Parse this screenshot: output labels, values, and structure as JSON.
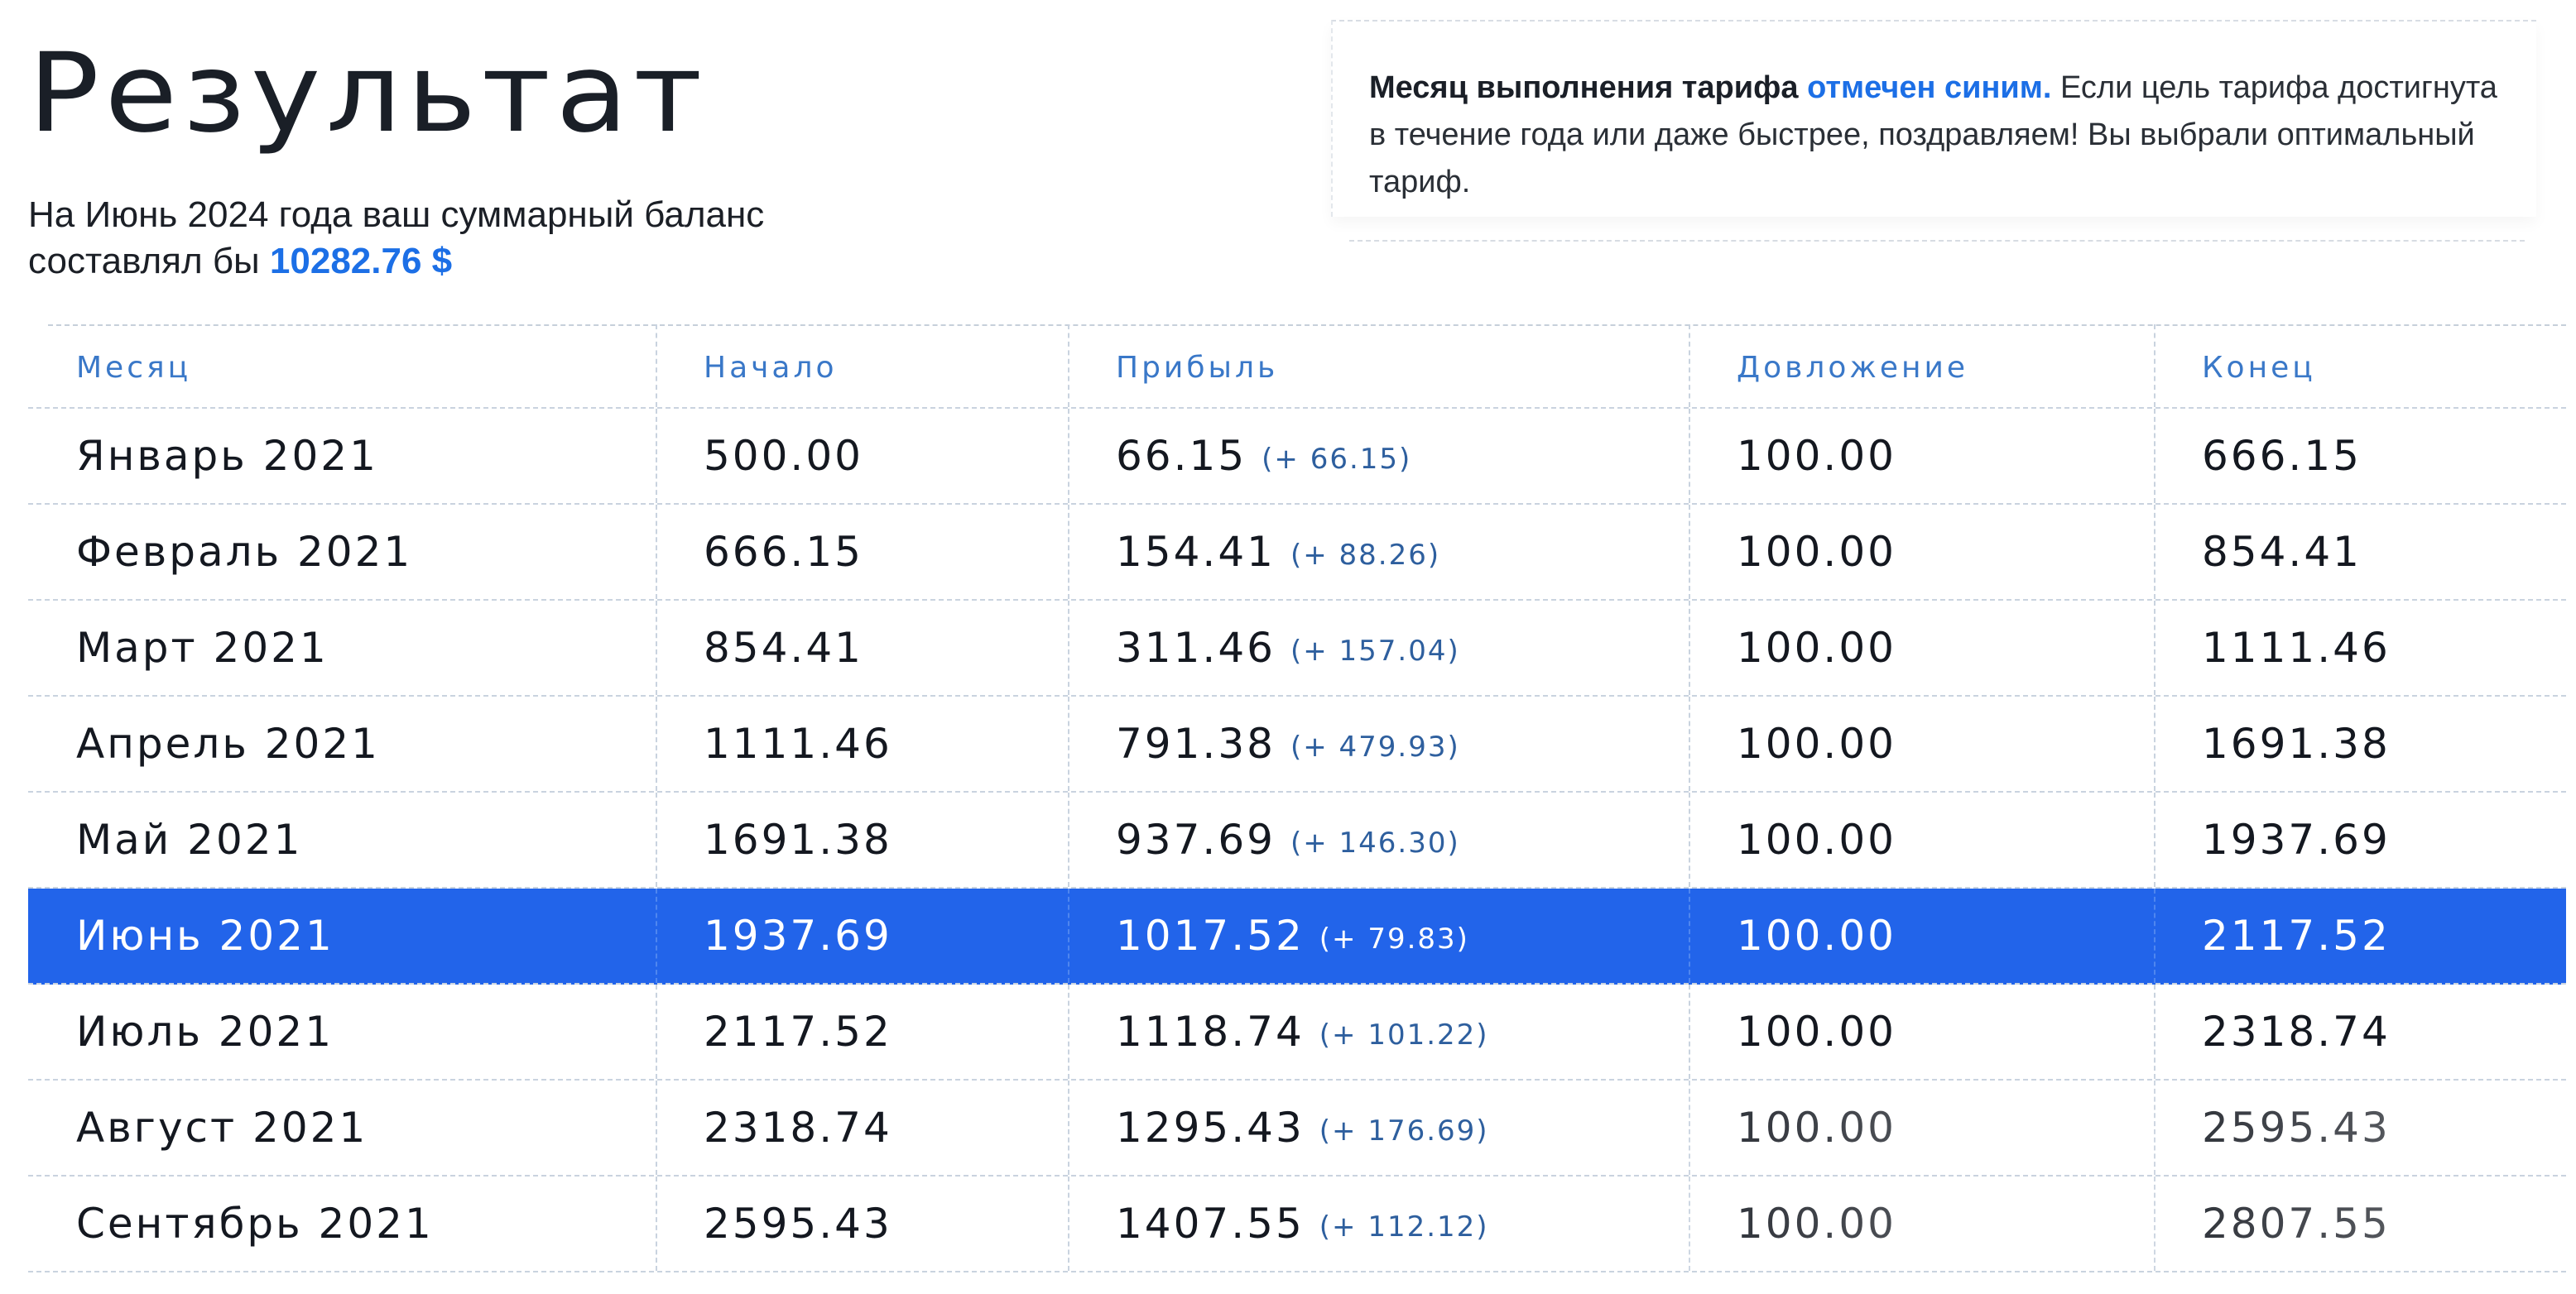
{
  "page": {
    "title": "Результат",
    "summary_text": "На Июнь 2024 года ваш суммарный баланс составлял бы",
    "summary_amount": "10282.76 $"
  },
  "note": {
    "lead_bold": "Месяц выполнения тарифа",
    "lead_blue": "отмечен синим.",
    "text": "Если цель тарифа достигнута в течение года или даже быстрее, поздравляем! Вы выбрали оптимальный тариф."
  },
  "colors": {
    "accent": "#1c6fe6",
    "highlight_row": "#2264ea",
    "header_text": "#3a78c8"
  },
  "table": {
    "columns": [
      "Месяц",
      "Начало",
      "Прибыль",
      "Довложение",
      "Конец"
    ],
    "highlighted_row_index": 5,
    "rows": [
      {
        "month": "Январь 2021",
        "start": "500.00",
        "profit": "66.15",
        "delta": "(+ 66.15)",
        "deposit": "100.00",
        "end": "666.15"
      },
      {
        "month": "Февраль 2021",
        "start": "666.15",
        "profit": "154.41",
        "delta": "(+ 88.26)",
        "deposit": "100.00",
        "end": "854.41"
      },
      {
        "month": "Март 2021",
        "start": "854.41",
        "profit": "311.46",
        "delta": "(+ 157.04)",
        "deposit": "100.00",
        "end": "1111.46"
      },
      {
        "month": "Апрель 2021",
        "start": "1111.46",
        "profit": "791.38",
        "delta": "(+ 479.93)",
        "deposit": "100.00",
        "end": "1691.38"
      },
      {
        "month": "Май 2021",
        "start": "1691.38",
        "profit": "937.69",
        "delta": "(+ 146.30)",
        "deposit": "100.00",
        "end": "1937.69"
      },
      {
        "month": "Июнь 2021",
        "start": "1937.69",
        "profit": "1017.52",
        "delta": "(+ 79.83)",
        "deposit": "100.00",
        "end": "2117.52"
      },
      {
        "month": "Июль 2021",
        "start": "2117.52",
        "profit": "1118.74",
        "delta": "(+ 101.22)",
        "deposit": "100.00",
        "end": "2318.74"
      },
      {
        "month": "Август 2021",
        "start": "2318.74",
        "profit": "1295.43",
        "delta": "(+ 176.69)",
        "deposit": "100.00",
        "end": "2595.43"
      },
      {
        "month": "Сентябрь 2021",
        "start": "2595.43",
        "profit": "1407.55",
        "delta": "(+ 112.12)",
        "deposit": "100.00",
        "end": "2807.55"
      }
    ]
  }
}
